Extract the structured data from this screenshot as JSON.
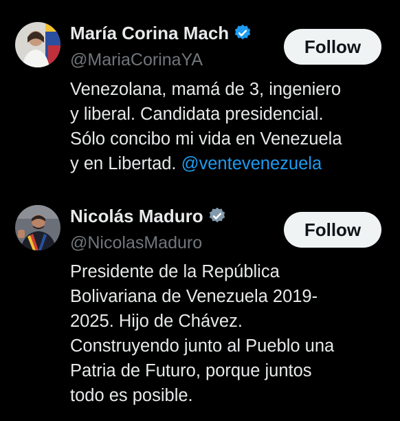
{
  "colors": {
    "background": "#000000",
    "text": "#e7e9ea",
    "muted": "#71767b",
    "link": "#1d9bf0",
    "button_bg": "#eff3f4",
    "button_text": "#0f1419",
    "verified_blue": "#1d9bf0",
    "verified_gray": "#829aab"
  },
  "users": [
    {
      "name": "María Corina Mach",
      "handle": "@MariaCorinaYA",
      "follow_label": "Follow",
      "badge_icon": "verified-blue-icon",
      "bio_lines": [
        "Venezolana, mamá de 3, ingeniero",
        "y liberal. Candidata presidencial.",
        "Sólo concibo mi vida en Venezuela",
        "y en Libertad. "
      ],
      "bio_mention": "@ventevenezuela"
    },
    {
      "name": "Nicolás Maduro",
      "handle": "@NicolasMaduro",
      "follow_label": "Follow",
      "badge_icon": "verified-gray-icon",
      "bio_lines": [
        "Presidente de la República",
        "Bolivariana de Venezuela 2019-",
        "2025. Hijo de Chávez.",
        "Construyendo junto al Pueblo una",
        "Patria de Futuro, porque juntos",
        "todo es posible."
      ]
    }
  ]
}
